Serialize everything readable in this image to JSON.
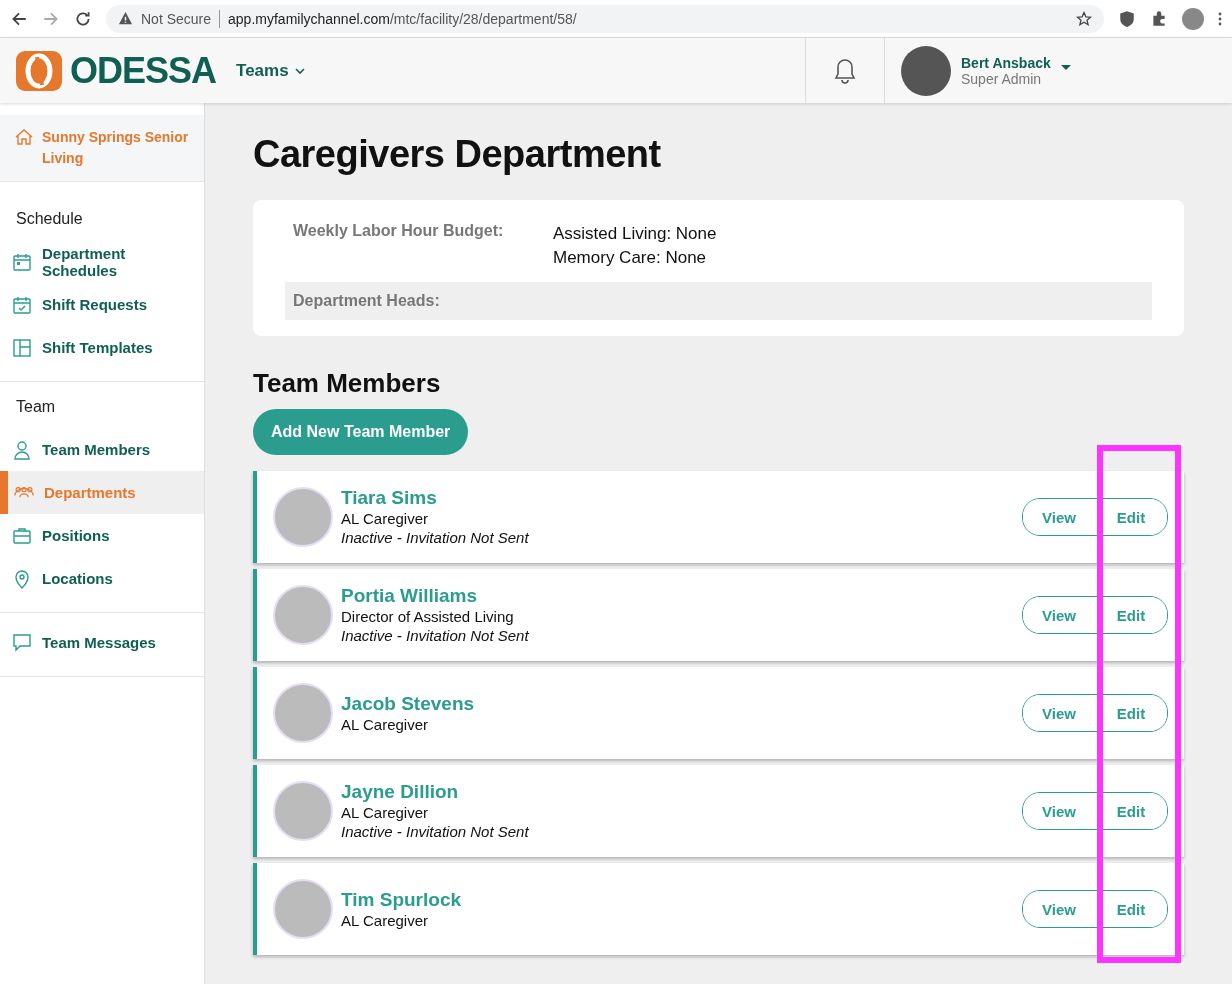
{
  "browser": {
    "security": "Not Secure",
    "url_host": "app.myfamilychannel.com",
    "url_path": "/mtc/facility/28/department/58/"
  },
  "header": {
    "logo": "ODESSA",
    "menu": "Teams",
    "user": {
      "name": "Bert Ansback",
      "role": "Super Admin"
    }
  },
  "sidebar": {
    "facility": "Sunny Springs Senior Living",
    "sections": [
      {
        "title": "Schedule",
        "items": [
          {
            "label": "Department Schedules",
            "selected": false
          },
          {
            "label": "Shift Requests",
            "selected": false
          },
          {
            "label": "Shift Templates",
            "selected": false
          }
        ]
      },
      {
        "title": "Team",
        "items": [
          {
            "label": "Team Members",
            "selected": false
          },
          {
            "label": "Departments",
            "selected": true
          },
          {
            "label": "Positions",
            "selected": false
          },
          {
            "label": "Locations",
            "selected": false
          }
        ]
      },
      {
        "items": [
          {
            "label": "Team Messages",
            "selected": false
          }
        ]
      }
    ]
  },
  "page": {
    "title": "Caregivers Department",
    "budget_label": "Weekly Labor Hour Budget:",
    "budget_values": [
      "Assisted Living: None",
      "Memory Care: None"
    ],
    "heads_label": "Department Heads:"
  },
  "team": {
    "title": "Team Members",
    "add_button": "Add New Team Member",
    "members": [
      {
        "name": "Tiara Sims",
        "position": "AL Caregiver",
        "status": "Inactive - Invitation Not Sent",
        "view": "View",
        "edit": "Edit"
      },
      {
        "name": "Portia Williams",
        "position": "Director of Assisted Living",
        "status": "Inactive - Invitation Not Sent",
        "view": "View",
        "edit": "Edit"
      },
      {
        "name": "Jacob Stevens",
        "position": "AL Caregiver",
        "view": "View",
        "edit": "Edit"
      },
      {
        "name": "Jayne Dillion",
        "position": "AL Caregiver",
        "status": "Inactive - Invitation Not Sent",
        "view": "View",
        "edit": "Edit"
      },
      {
        "name": "Tim Spurlock",
        "position": "AL Caregiver",
        "view": "View",
        "edit": "Edit"
      }
    ]
  }
}
